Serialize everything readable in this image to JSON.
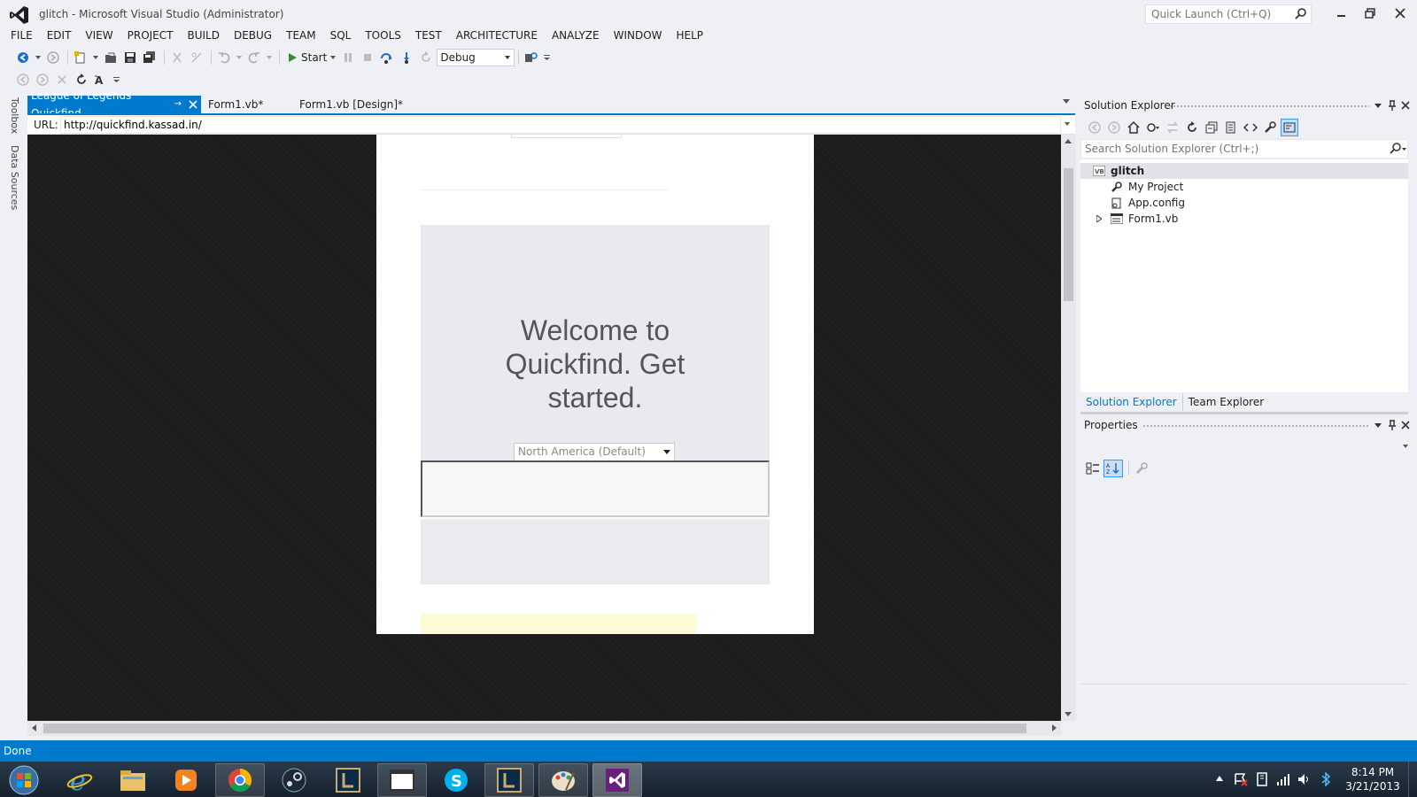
{
  "window": {
    "title": "glitch - Microsoft Visual Studio (Administrator)",
    "quick_launch_placeholder": "Quick Launch (Ctrl+Q)"
  },
  "menu": [
    "FILE",
    "EDIT",
    "VIEW",
    "PROJECT",
    "BUILD",
    "DEBUG",
    "TEAM",
    "SQL",
    "TOOLS",
    "TEST",
    "ARCHITECTURE",
    "ANALYZE",
    "WINDOW",
    "HELP"
  ],
  "toolbar": {
    "start_label": "Start",
    "configuration": "Debug"
  },
  "left_rail": {
    "toolbox": "Toolbox",
    "data_sources": "Data Sources"
  },
  "doc_tabs": [
    {
      "label": "League of Legends Quickfind",
      "active": true
    },
    {
      "label": "Form1.vb*",
      "active": false
    },
    {
      "label": "Form1.vb [Design]*",
      "active": false
    }
  ],
  "browser": {
    "url_label": "URL:",
    "url": "http://quickfind.kassad.in/",
    "welcome": "Welcome to Quickfind. Get started.",
    "region": "North America (Default)"
  },
  "solution_explorer": {
    "title": "Solution Explorer",
    "search_placeholder": "Search Solution Explorer (Ctrl+;)",
    "tree": [
      {
        "label": "glitch",
        "icon": "vb-solution-icon"
      },
      {
        "label": "My Project",
        "icon": "wrench-icon"
      },
      {
        "label": "App.config",
        "icon": "config-file-icon"
      },
      {
        "label": "Form1.vb",
        "icon": "form-icon"
      }
    ],
    "tabs": [
      "Solution Explorer",
      "Team Explorer"
    ]
  },
  "properties": {
    "title": "Properties"
  },
  "status": {
    "text": "Done"
  },
  "taskbar": {
    "time": "8:14 PM",
    "date": "3/21/2013"
  },
  "colors": {
    "accent": "#007acc",
    "chrome": "#eef0f5",
    "browser_bg": "#1b1b1b",
    "taskbar": "#1c2b3a"
  }
}
